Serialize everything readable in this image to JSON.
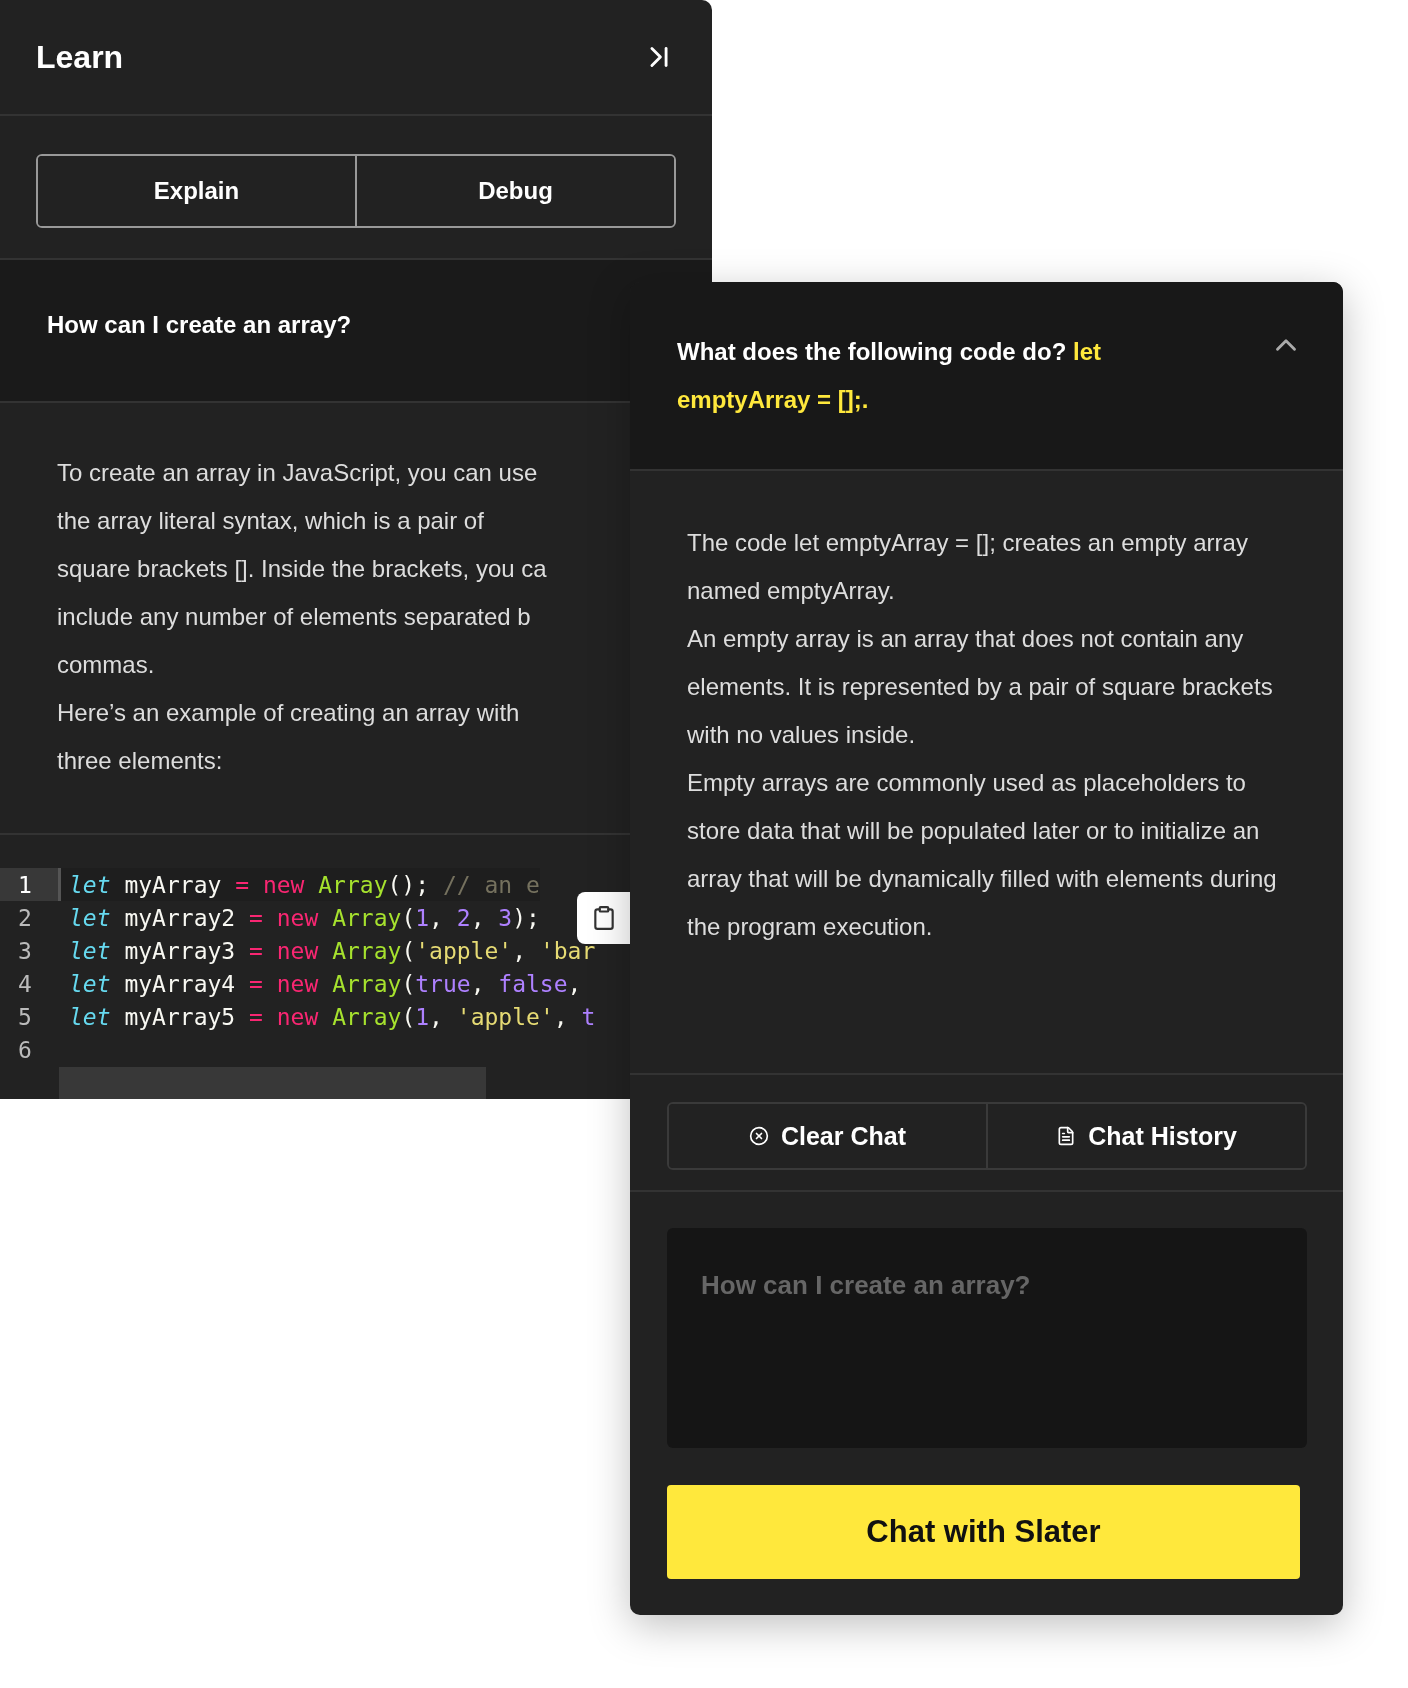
{
  "learn_panel": {
    "title": "Learn",
    "tabs": [
      {
        "label": "Explain"
      },
      {
        "label": "Debug"
      }
    ],
    "question": "How can I create an array?",
    "answer": [
      [
        "To create an array in JavaScript, you can use",
        "the array literal syntax, which is a pair of",
        "square brackets []. Inside the brackets, you ca",
        "include any number of elements separated b",
        "commas."
      ],
      [
        "Here’s an example of creating an array with",
        "three elements:"
      ]
    ],
    "code_lines": [
      {
        "number": "1",
        "active": true,
        "tokens": [
          {
            "kind": "keyword",
            "text": "let"
          },
          {
            "kind": "plain",
            "text": " myArray "
          },
          {
            "kind": "op",
            "text": "= "
          },
          {
            "kind": "op",
            "text": "new"
          },
          {
            "kind": "func",
            "text": " Array"
          },
          {
            "kind": "plain",
            "text": "(); "
          },
          {
            "kind": "comment",
            "text": "// an e"
          }
        ]
      },
      {
        "number": "2",
        "active": false,
        "tokens": [
          {
            "kind": "keyword",
            "text": "let"
          },
          {
            "kind": "plain",
            "text": " myArray2 "
          },
          {
            "kind": "op",
            "text": "= "
          },
          {
            "kind": "op",
            "text": "new"
          },
          {
            "kind": "func",
            "text": " Array"
          },
          {
            "kind": "plain",
            "text": "("
          },
          {
            "kind": "num",
            "text": "1"
          },
          {
            "kind": "plain",
            "text": ", "
          },
          {
            "kind": "num",
            "text": "2"
          },
          {
            "kind": "plain",
            "text": ", "
          },
          {
            "kind": "num",
            "text": "3"
          },
          {
            "kind": "plain",
            "text": ");"
          }
        ]
      },
      {
        "number": "3",
        "active": false,
        "tokens": [
          {
            "kind": "keyword",
            "text": "let"
          },
          {
            "kind": "plain",
            "text": " myArray3 "
          },
          {
            "kind": "op",
            "text": "= "
          },
          {
            "kind": "op",
            "text": "new"
          },
          {
            "kind": "func",
            "text": " Array"
          },
          {
            "kind": "plain",
            "text": "("
          },
          {
            "kind": "str",
            "text": "'apple'"
          },
          {
            "kind": "plain",
            "text": ", "
          },
          {
            "kind": "str",
            "text": "'bar"
          }
        ]
      },
      {
        "number": "4",
        "active": false,
        "tokens": [
          {
            "kind": "keyword",
            "text": "let"
          },
          {
            "kind": "plain",
            "text": " myArray4 "
          },
          {
            "kind": "op",
            "text": "= "
          },
          {
            "kind": "op",
            "text": "new"
          },
          {
            "kind": "func",
            "text": " Array"
          },
          {
            "kind": "plain",
            "text": "("
          },
          {
            "kind": "num",
            "text": "true"
          },
          {
            "kind": "plain",
            "text": ", "
          },
          {
            "kind": "num",
            "text": "false"
          },
          {
            "kind": "plain",
            "text": ","
          }
        ]
      },
      {
        "number": "5",
        "active": false,
        "tokens": [
          {
            "kind": "keyword",
            "text": "let"
          },
          {
            "kind": "plain",
            "text": " myArray5 "
          },
          {
            "kind": "op",
            "text": "= "
          },
          {
            "kind": "op",
            "text": "new"
          },
          {
            "kind": "func",
            "text": " Array"
          },
          {
            "kind": "plain",
            "text": "("
          },
          {
            "kind": "num",
            "text": "1"
          },
          {
            "kind": "plain",
            "text": ", "
          },
          {
            "kind": "str",
            "text": "'apple'"
          },
          {
            "kind": "plain",
            "text": ", "
          },
          {
            "kind": "num",
            "text": "t"
          }
        ]
      },
      {
        "number": "6",
        "active": false
      }
    ]
  },
  "chat_panel": {
    "question": "What does the following code do?",
    "question_code": "let emptyArray = [];.",
    "answer": [
      "The code let emptyArray = []; creates an empty array named emptyArray.",
      "An empty array is an array that does not contain any elements. It is represented by a pair of square brackets with no values inside.",
      "Empty arrays are commonly used as placeholders to store data that will be populated later or to initialize an array that will be dynamically filled with elements during the program execution."
    ],
    "actions": [
      {
        "kind": "clear",
        "label": "Clear Chat"
      },
      {
        "kind": "history",
        "label": "Chat History"
      }
    ],
    "input": {
      "placeholder": "How can I create an array?"
    },
    "submit": "Chat with Slater"
  }
}
